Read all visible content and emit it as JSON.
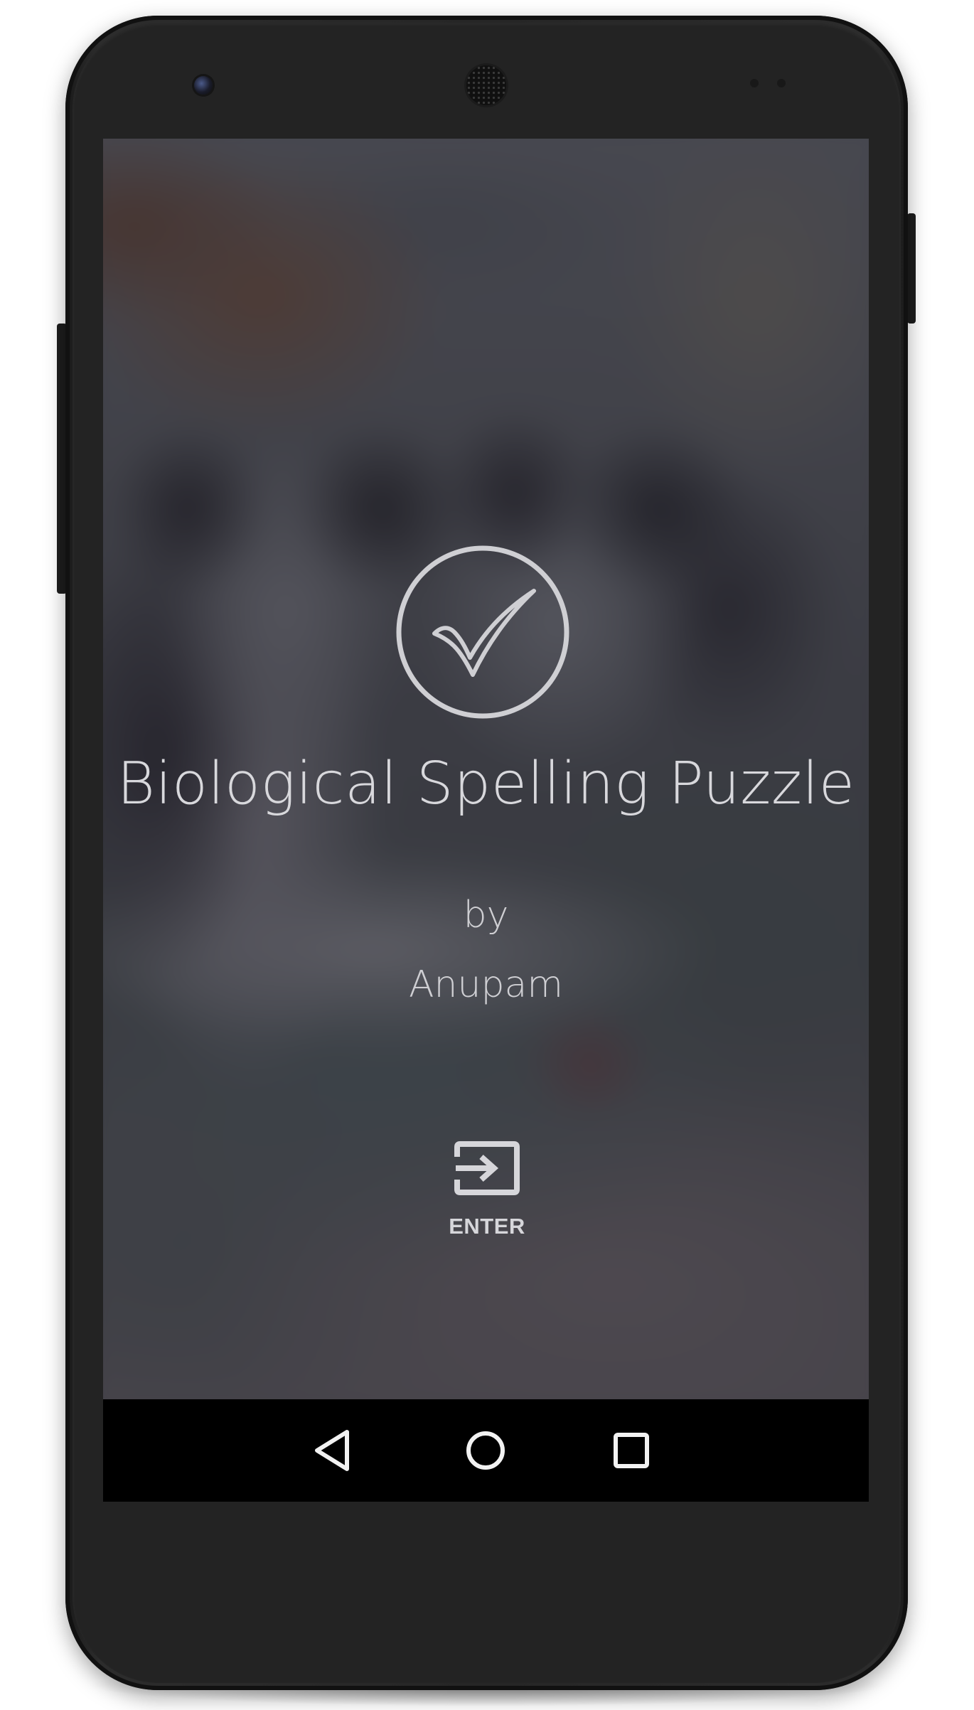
{
  "app": {
    "title": "Biological Spelling Puzzle",
    "by_label": "by",
    "author": "Anupam"
  },
  "actions": {
    "enter_label": "ENTER",
    "enter_icon": "input-enter-icon"
  },
  "logo": {
    "icon": "checkmark-circle-icon"
  },
  "nav_bar": {
    "back_icon": "back-triangle-icon",
    "home_icon": "home-circle-icon",
    "recents_icon": "recents-square-icon"
  },
  "colors": {
    "text_primary": "#d8d8dc",
    "scrim": "#28283080",
    "nav_bar": "#000000"
  }
}
